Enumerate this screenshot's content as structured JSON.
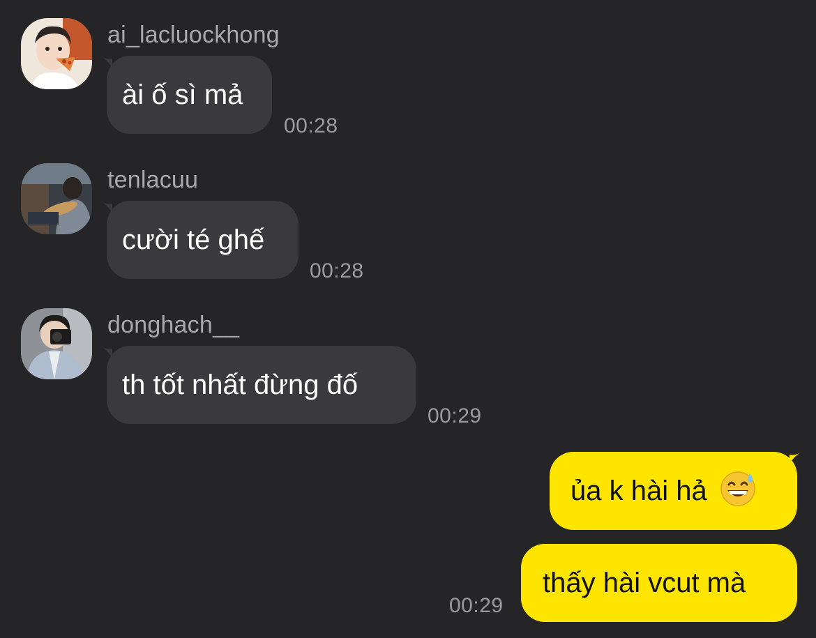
{
  "colors": {
    "background": "#252527",
    "incoming_bubble": "#3a3a3c",
    "outgoing_bubble": "#fde500",
    "sender_name": "#a9a9ad",
    "timestamp": "#9c9ca0"
  },
  "messages": [
    {
      "sender": "ai_lacluockhong",
      "text": "ài ố sì mả",
      "time": "00:28",
      "avatar_icon": "avatar-photo-icon"
    },
    {
      "sender": "tenlacuu",
      "text": "cười té ghế",
      "time": "00:28",
      "avatar_icon": "avatar-photo-icon"
    },
    {
      "sender": "donghach__",
      "text": "th tốt nhất đừng đố",
      "time": "00:29",
      "avatar_icon": "avatar-photo-icon"
    }
  ],
  "outgoing": [
    {
      "text": "ủa k hài hả",
      "emoji": "grinning-sweat-emoji"
    },
    {
      "text": "thấy hài vcut mà",
      "time": "00:29"
    }
  ]
}
